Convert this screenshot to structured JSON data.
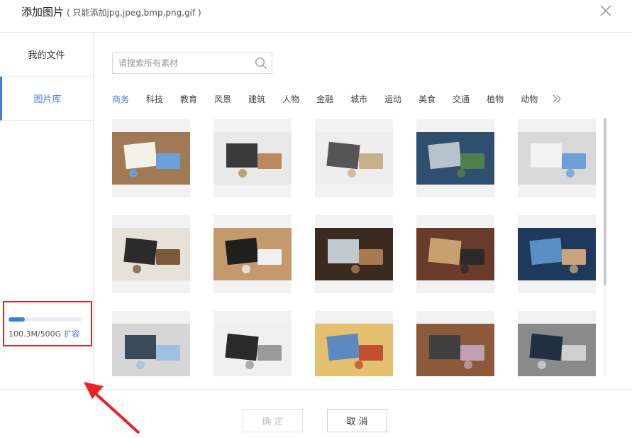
{
  "header": {
    "title": "添加图片",
    "subtitle": "( 只能添加jpg,jpeg,bmp,png,gif )"
  },
  "sidebar": {
    "items": [
      {
        "label": "我的文件"
      },
      {
        "label": "图片库"
      }
    ],
    "storage": {
      "used": "100.3M",
      "total": "500G",
      "text": "100.3M/500G",
      "expand_label": "扩容",
      "usage_fraction": 0.22
    }
  },
  "search": {
    "placeholder": "请搜索所有素材",
    "value": ""
  },
  "categories": [
    "商务",
    "科技",
    "教育",
    "风景",
    "建筑",
    "人物",
    "金融",
    "城市",
    "运动",
    "美食",
    "交通",
    "植物",
    "动物"
  ],
  "active_category": "商务",
  "footer": {
    "ok_label": "确 定",
    "cancel_label": "取 消"
  },
  "icons": [
    "close-icon",
    "search-icon",
    "double-chevron-right-icon"
  ],
  "colors": {
    "accent": "#4a7fd6",
    "annotation": "#f02020"
  }
}
